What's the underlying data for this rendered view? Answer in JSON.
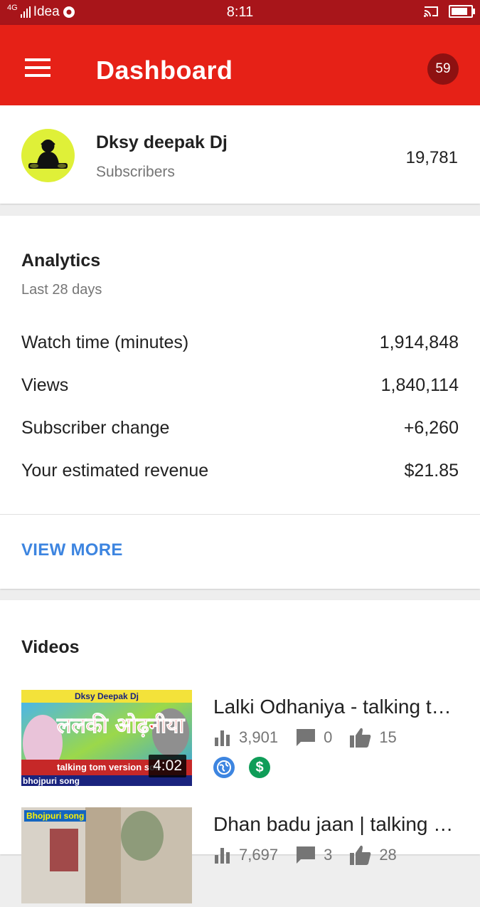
{
  "status_bar": {
    "carrier": "Idea",
    "network": "4G",
    "time": "8:11",
    "battery_level": 0.85
  },
  "app_bar": {
    "title": "Dashboard",
    "notification_count": "59",
    "accent_color": "#e62117"
  },
  "channel": {
    "name": "Dksy deepak Dj",
    "subscribers_label": "Subscribers",
    "subscribers_count": "19,781"
  },
  "analytics": {
    "title": "Analytics",
    "period": "Last 28 days",
    "metrics": [
      {
        "label": "Watch time (minutes)",
        "value": "1,914,848"
      },
      {
        "label": "Views",
        "value": "1,840,114"
      },
      {
        "label": "Subscriber change",
        "value": "+6,260"
      },
      {
        "label": "Your estimated revenue",
        "value": "$21.85"
      }
    ],
    "view_more": "VIEW MORE",
    "link_color": "#3d85e0"
  },
  "videos": {
    "title": "Videos",
    "items": [
      {
        "title": "Lalki Odhaniya - talking tom version song",
        "duration": "4:02",
        "views": "3,901",
        "comments": "0",
        "likes": "15",
        "thumb_header": "Dksy Deepak Dj",
        "thumb_title": "ललकी ओढ़नीया",
        "thumb_caption": "talking tom version son",
        "thumb_footer": "bhojpuri song"
      },
      {
        "title": "Dhan badu jaan | talking tom version",
        "views": "7,697",
        "comments": "3",
        "likes": "28",
        "thumb_header": "Bhojpuri song"
      }
    ]
  }
}
